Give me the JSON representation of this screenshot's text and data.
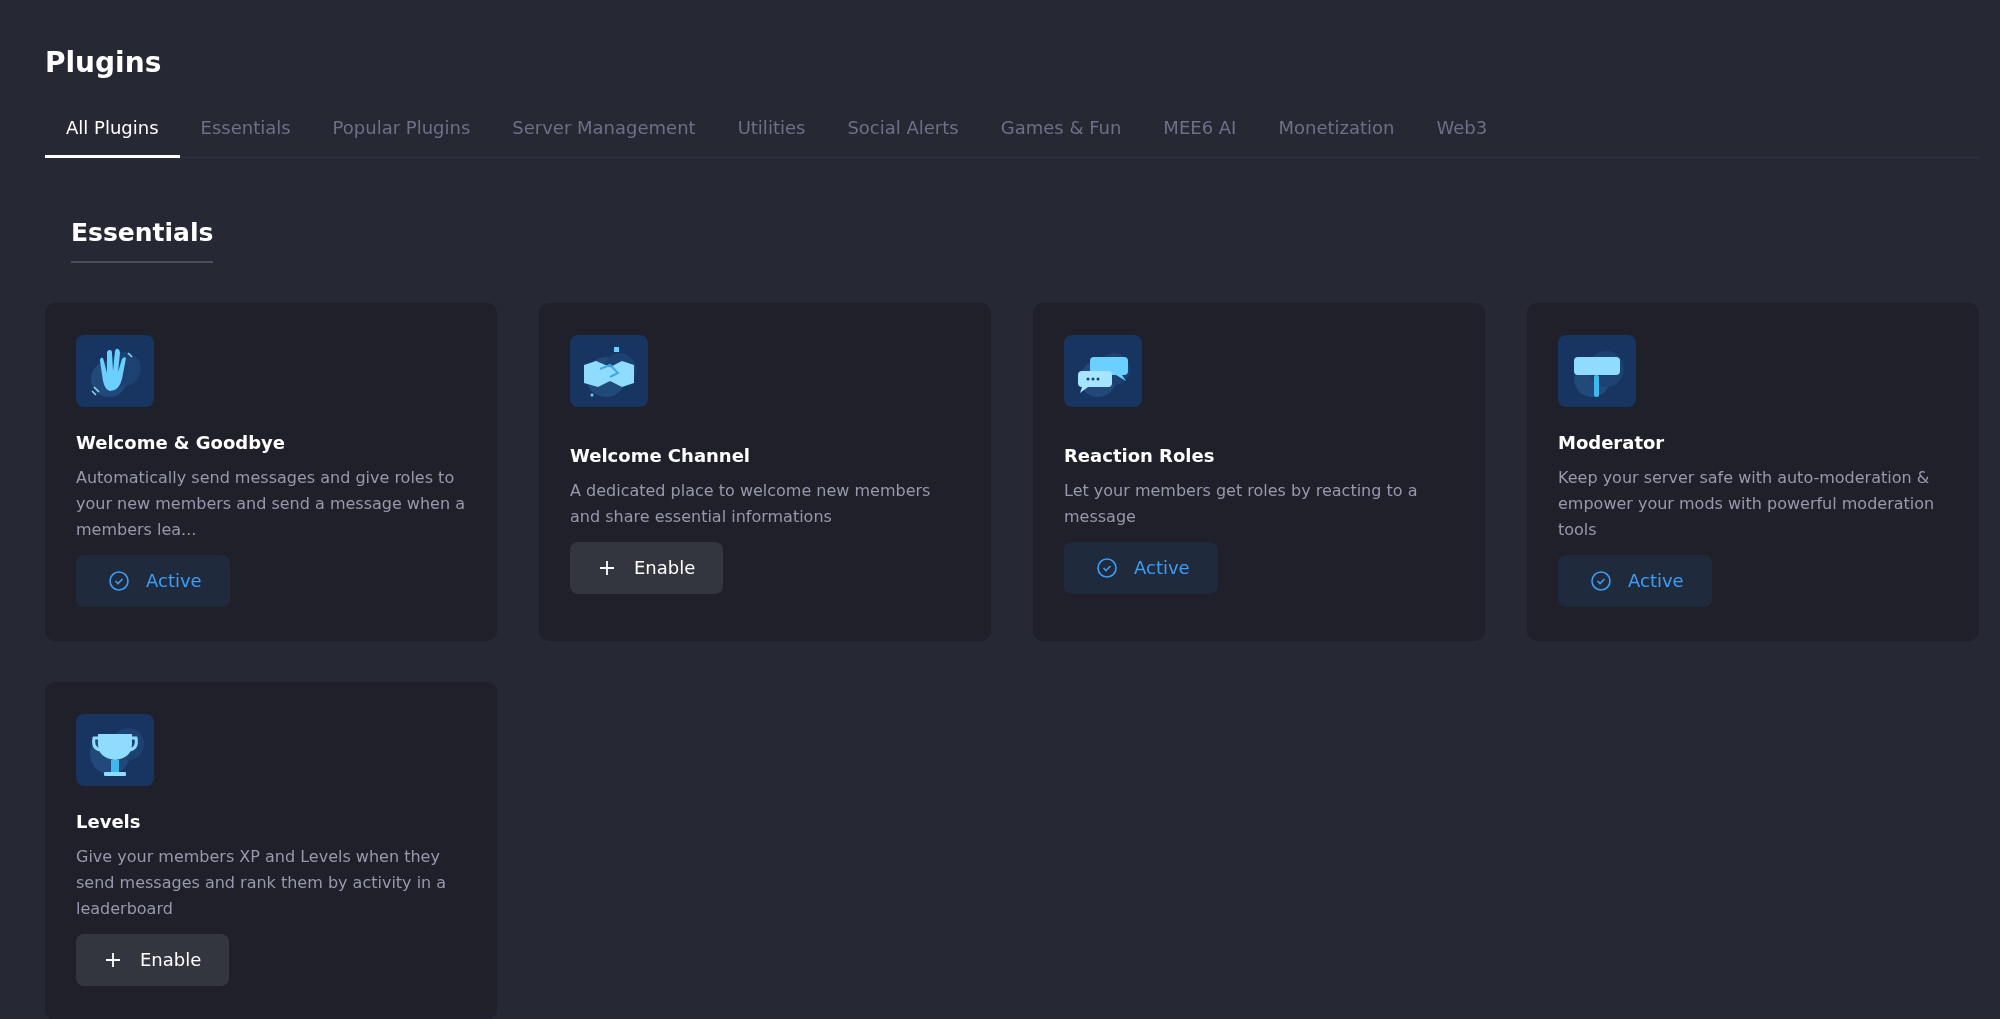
{
  "page": {
    "title": "Plugins"
  },
  "tabs": [
    {
      "label": "All Plugins",
      "selected": true
    },
    {
      "label": "Essentials",
      "selected": false
    },
    {
      "label": "Popular Plugins",
      "selected": false
    },
    {
      "label": "Server Management",
      "selected": false
    },
    {
      "label": "Utilities",
      "selected": false
    },
    {
      "label": "Social Alerts",
      "selected": false
    },
    {
      "label": "Games & Fun",
      "selected": false
    },
    {
      "label": "MEE6 AI",
      "selected": false
    },
    {
      "label": "Monetization",
      "selected": false
    },
    {
      "label": "Web3",
      "selected": false
    }
  ],
  "section": {
    "title": "Essentials"
  },
  "plugins": [
    {
      "kind": "hand",
      "name": "Welcome & Goodbye",
      "description": "Automatically send messages and give roles to your new members and send a message when a members lea...",
      "button": {
        "kind": "active",
        "label": "Active"
      }
    },
    {
      "kind": "handshake",
      "name": "Welcome Channel",
      "description": "A dedicated place to welcome new members and share essential informations",
      "button": {
        "kind": "enable",
        "label": "Enable"
      }
    },
    {
      "kind": "chat",
      "name": "Reaction Roles",
      "description": "Let your members get roles by reacting to a message",
      "button": {
        "kind": "active",
        "label": "Active"
      }
    },
    {
      "kind": "hammer",
      "name": "Moderator",
      "description": "Keep your server safe with auto-moderation & empower your mods with powerful moderation tools",
      "button": {
        "kind": "active",
        "label": "Active"
      }
    },
    {
      "kind": "trophy",
      "name": "Levels",
      "description": "Give your members XP and Levels when they send messages and rank them by activity in a leaderboard",
      "button": {
        "kind": "enable",
        "label": "Enable"
      }
    }
  ]
}
